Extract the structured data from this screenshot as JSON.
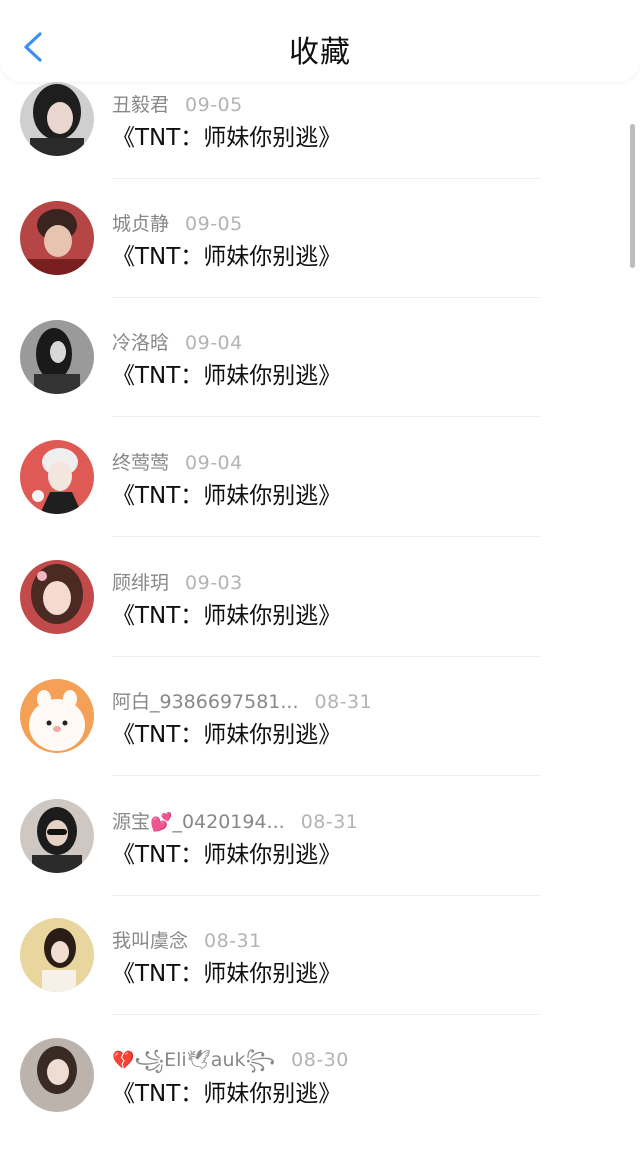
{
  "header": {
    "title": "收藏",
    "back_icon": "chevron-left-icon",
    "accent_color": "#3a8ef6"
  },
  "items": [
    {
      "name": "丑毅君",
      "date": "09-05",
      "title": "《TNT：师妹你别逃》"
    },
    {
      "name": "城贞静",
      "date": "09-05",
      "title": "《TNT：师妹你别逃》"
    },
    {
      "name": "冷洛晗",
      "date": "09-04",
      "title": "《TNT：师妹你别逃》"
    },
    {
      "name": "终莺莺",
      "date": "09-04",
      "title": "《TNT：师妹你别逃》"
    },
    {
      "name": "顾绯玥",
      "date": "09-03",
      "title": "《TNT：师妹你别逃》"
    },
    {
      "name": "阿白_9386697581...",
      "date": "08-31",
      "title": "《TNT：师妹你别逃》"
    },
    {
      "name_prefix": "源宝",
      "name_suffix": "_0420194...",
      "name_emoji": "💕",
      "date": "08-31",
      "title": "《TNT：师妹你别逃》"
    },
    {
      "name": "我叫虞念",
      "date": "08-31",
      "title": "《TNT：师妹你别逃》"
    },
    {
      "name_emoji": "💔",
      "name_a": "꧁Eli",
      "name_emoji2": "🕊",
      "name_b": "auk꧂",
      "date": "08-30",
      "title": "《TNT：师妹你别逃》"
    }
  ]
}
